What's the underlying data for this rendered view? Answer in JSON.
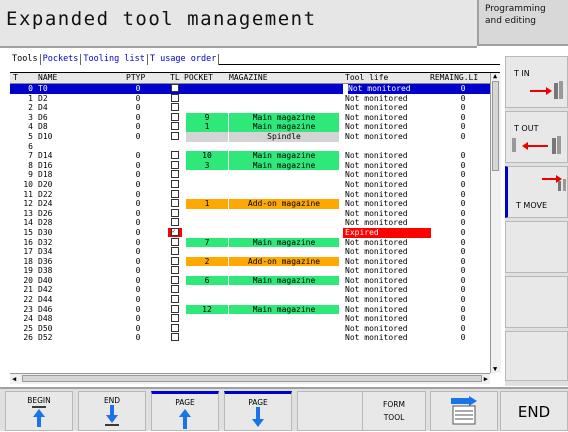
{
  "header": {
    "title": "Expanded tool management",
    "mode_line1": "Programming",
    "mode_line2": "and editing"
  },
  "tabs": [
    "Tools",
    "Pockets",
    "Tooling list",
    "T usage order"
  ],
  "columns": {
    "t": "T",
    "name": "NAME",
    "ptyp": "PTYP",
    "tl": "TL",
    "pocket": "POCKET",
    "magazine": "MAGAZINE",
    "life": "Tool life",
    "rem": "REMAING.LI"
  },
  "rows": [
    {
      "t": "0",
      "name": "T0",
      "ptyp": "0",
      "pocket": "",
      "magazine": "",
      "life": "Not monitored",
      "rem": "0",
      "selected": true,
      "life_marker": true
    },
    {
      "t": "1",
      "name": "D2",
      "ptyp": "0",
      "pocket": "",
      "magazine": "",
      "life": "Not monitored",
      "rem": "0"
    },
    {
      "t": "2",
      "name": "D4",
      "ptyp": "0",
      "pocket": "",
      "magazine": "",
      "life": "Not monitored",
      "rem": "0"
    },
    {
      "t": "3",
      "name": "D6",
      "ptyp": "0",
      "pocket": "9",
      "magazine": "Main magazine",
      "life": "Not monitored",
      "rem": "0",
      "mag_color": "green"
    },
    {
      "t": "4",
      "name": "D8",
      "ptyp": "0",
      "pocket": "1",
      "magazine": "Main magazine",
      "life": "Not monitored",
      "rem": "0",
      "mag_color": "green"
    },
    {
      "t": "5",
      "name": "D10",
      "ptyp": "0",
      "pocket": "",
      "magazine": "Spindle",
      "life": "Not monitored",
      "rem": "0",
      "mag_color": "grey"
    },
    {
      "t": "6",
      "name": "",
      "ptyp": "",
      "pocket": "",
      "magazine": "",
      "life": "",
      "rem": "",
      "no_tl": true
    },
    {
      "t": "7",
      "name": "D14",
      "ptyp": "0",
      "pocket": "10",
      "magazine": "Main magazine",
      "life": "Not monitored",
      "rem": "0",
      "mag_color": "green"
    },
    {
      "t": "8",
      "name": "D16",
      "ptyp": "0",
      "pocket": "3",
      "magazine": "Main magazine",
      "life": "Not monitored",
      "rem": "0",
      "mag_color": "green"
    },
    {
      "t": "9",
      "name": "D18",
      "ptyp": "0",
      "pocket": "",
      "magazine": "",
      "life": "Not monitored",
      "rem": "0"
    },
    {
      "t": "10",
      "name": "D20",
      "ptyp": "0",
      "pocket": "",
      "magazine": "",
      "life": "Not monitored",
      "rem": "0"
    },
    {
      "t": "11",
      "name": "D22",
      "ptyp": "0",
      "pocket": "",
      "magazine": "",
      "life": "Not monitored",
      "rem": "0"
    },
    {
      "t": "12",
      "name": "D24",
      "ptyp": "0",
      "pocket": "1",
      "magazine": "Add-on magazine",
      "life": "Not monitored",
      "rem": "0",
      "mag_color": "orange"
    },
    {
      "t": "13",
      "name": "D26",
      "ptyp": "0",
      "pocket": "",
      "magazine": "",
      "life": "Not monitored",
      "rem": "0"
    },
    {
      "t": "14",
      "name": "D28",
      "ptyp": "0",
      "pocket": "",
      "magazine": "",
      "life": "Not monitored",
      "rem": "0"
    },
    {
      "t": "15",
      "name": "D30",
      "ptyp": "0",
      "pocket": "",
      "magazine": "",
      "life": "Expired",
      "rem": "0",
      "expired": true
    },
    {
      "t": "16",
      "name": "D32",
      "ptyp": "0",
      "pocket": "7",
      "magazine": "Main magazine",
      "life": "Not monitored",
      "rem": "0",
      "mag_color": "green"
    },
    {
      "t": "17",
      "name": "D34",
      "ptyp": "0",
      "pocket": "",
      "magazine": "",
      "life": "Not monitored",
      "rem": "0"
    },
    {
      "t": "18",
      "name": "D36",
      "ptyp": "0",
      "pocket": "2",
      "magazine": "Add-on magazine",
      "life": "Not monitored",
      "rem": "0",
      "mag_color": "orange"
    },
    {
      "t": "19",
      "name": "D38",
      "ptyp": "0",
      "pocket": "",
      "magazine": "",
      "life": "Not monitored",
      "rem": "0"
    },
    {
      "t": "20",
      "name": "D40",
      "ptyp": "0",
      "pocket": "6",
      "magazine": "Main magazine",
      "life": "Not monitored",
      "rem": "0",
      "mag_color": "green"
    },
    {
      "t": "21",
      "name": "D42",
      "ptyp": "0",
      "pocket": "",
      "magazine": "",
      "life": "Not monitored",
      "rem": "0"
    },
    {
      "t": "22",
      "name": "D44",
      "ptyp": "0",
      "pocket": "",
      "magazine": "",
      "life": "Not monitored",
      "rem": "0"
    },
    {
      "t": "23",
      "name": "D46",
      "ptyp": "0",
      "pocket": "12",
      "magazine": "Main magazine",
      "life": "Not monitored",
      "rem": "0",
      "mag_color": "green"
    },
    {
      "t": "24",
      "name": "D48",
      "ptyp": "0",
      "pocket": "",
      "magazine": "",
      "life": "Not monitored",
      "rem": "0"
    },
    {
      "t": "25",
      "name": "D50",
      "ptyp": "0",
      "pocket": "",
      "magazine": "",
      "life": "Not monitored",
      "rem": "0"
    },
    {
      "t": "26",
      "name": "D52",
      "ptyp": "0",
      "pocket": "",
      "magazine": "",
      "life": "Not monitored",
      "rem": "0"
    }
  ],
  "side_keys": [
    {
      "label": "T IN",
      "icon": "tool-in-icon"
    },
    {
      "label": "T OUT",
      "icon": "tool-out-icon"
    },
    {
      "label": "T MOVE",
      "icon": "tool-move-icon"
    }
  ],
  "bottom_keys": {
    "begin": "BEGIN",
    "end_line": "END",
    "page_up": "PAGE",
    "page_down": "PAGE",
    "form1": "FORM",
    "form2": "TOOL",
    "end": "END"
  },
  "colors": {
    "selected": "#0000cc",
    "green": "#2ee87a",
    "orange": "#ffa800",
    "expired": "#ff0000"
  }
}
